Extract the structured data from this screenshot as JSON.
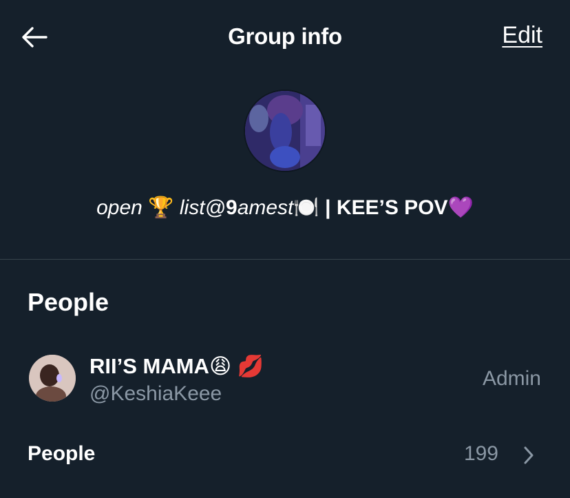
{
  "header": {
    "title": "Group info",
    "edit_label": "Edit",
    "back_icon": "arrow-left-icon"
  },
  "group": {
    "name_open": "open",
    "name_trophy": "🏆",
    "name_list": "list@",
    "name_9": "9",
    "name_amest": "amest",
    "name_plate": "🍽️",
    "name_rest": "| KEE’S POV",
    "name_heart": "💜"
  },
  "people_section": {
    "title": "People",
    "member": {
      "name": "RII’S MAMA",
      "emoji_1": "😩",
      "emoji_2": "💋",
      "handle": "@KeshiaKeee",
      "role": "Admin"
    },
    "people_row": {
      "label": "People",
      "count": "199",
      "chevron_icon": "chevron-right-icon"
    }
  },
  "colors": {
    "background": "#15202b",
    "text": "#ffffff",
    "secondary": "#8b98a5",
    "divider": "#38444d"
  }
}
